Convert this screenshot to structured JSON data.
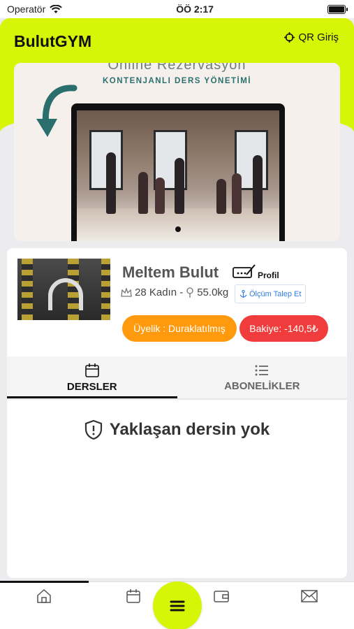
{
  "status_bar": {
    "carrier": "Operatör",
    "time": "ÖÖ 2:17"
  },
  "header": {
    "title": "BulutGYM",
    "qr_label": "QR Giriş"
  },
  "banner": {
    "top_text": "Online Rezervasyon",
    "subtitle": "KONTENJANLI DERS YÖNETİMİ"
  },
  "profile": {
    "name": "Meltem Bulut",
    "profile_link": "Profil",
    "age_gender": "28 Kadın -",
    "weight": "55.0kg",
    "measure_button": "Ölçüm Talep Et",
    "membership": "Üyelik : Duraklatılmış",
    "balance": "Bakiye: -140,5₺"
  },
  "tabs": [
    {
      "label": "DERSLER",
      "active": true
    },
    {
      "label": "ABONELİKLER",
      "active": false
    }
  ],
  "empty_message": "Yaklaşan dersin yok",
  "colors": {
    "accent": "#d7f507",
    "orange": "#ff9a0e",
    "red": "#f03c3c"
  }
}
